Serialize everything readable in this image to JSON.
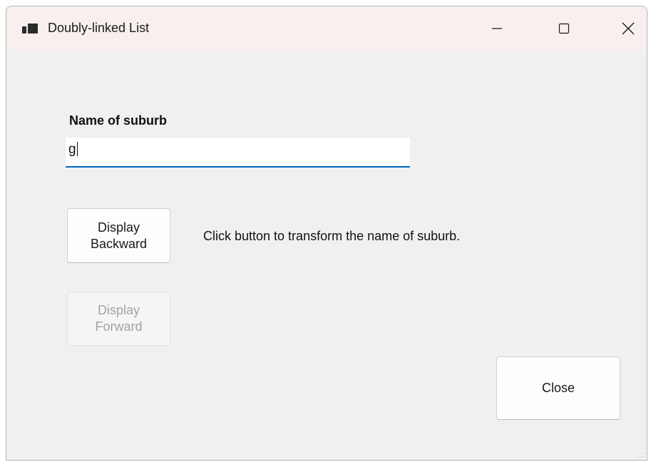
{
  "window": {
    "title": "Doubly-linked List",
    "app_icon": "form-window-icon",
    "caption_buttons": {
      "minimize": "minimize-icon",
      "maximize": "maximize-icon",
      "close": "close-icon"
    }
  },
  "form": {
    "suburb_label": "Name of suburb",
    "suburb_value": "g",
    "display_backward_label": [
      "Display",
      "Backward"
    ],
    "display_forward_label": [
      "Display",
      "Forward"
    ],
    "display_forward_enabled": false,
    "hint_text": "Click button to transform the name of suburb.",
    "close_label": "Close"
  },
  "colors": {
    "focus_underline": "#0067c0",
    "titlebar_bg": "#f7f0ef",
    "window_bg": "#f0f0f0"
  }
}
